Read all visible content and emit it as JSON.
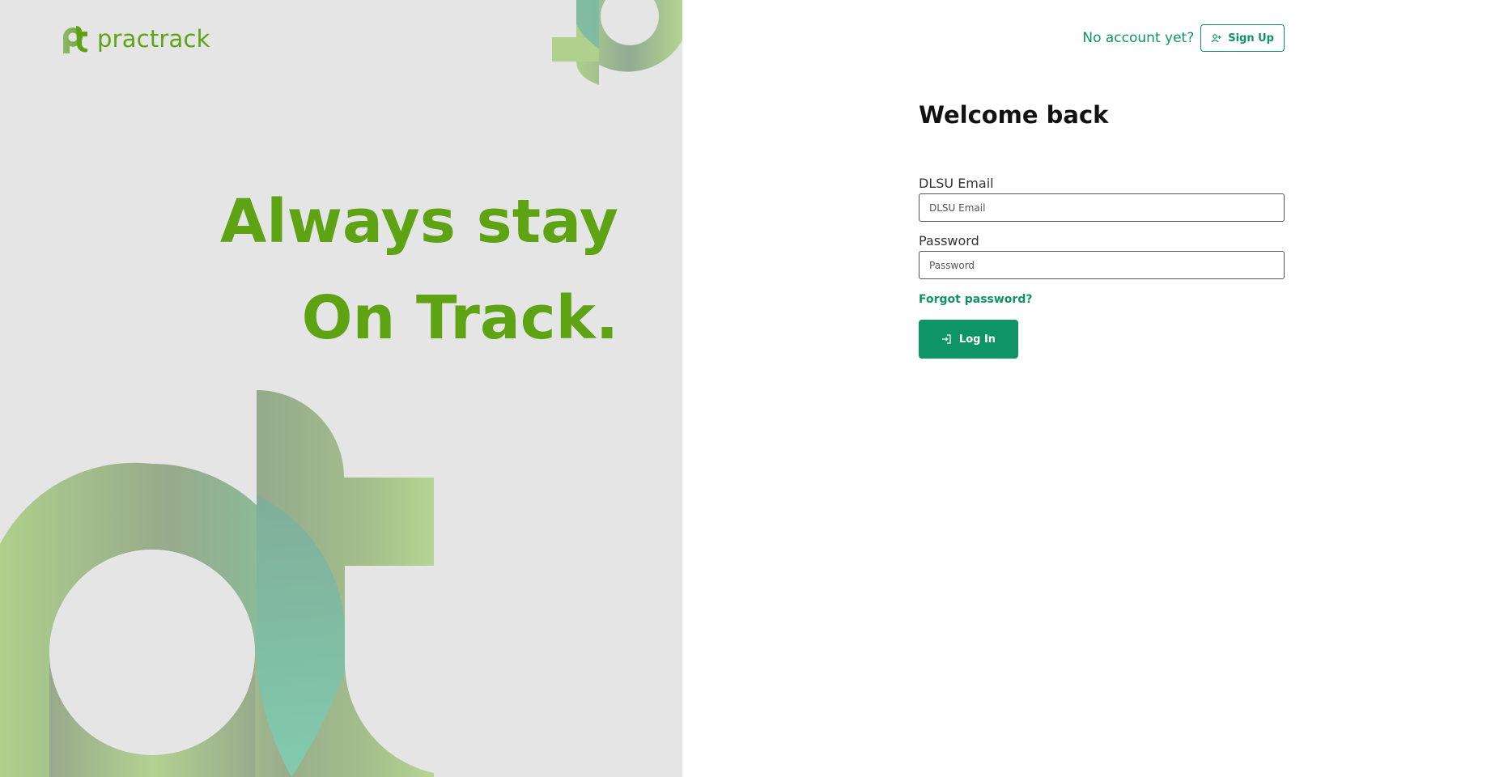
{
  "brand": {
    "name": "practrack",
    "logo_icon": "practrack-logo-icon",
    "brand_color": "#5da313",
    "accent_color": "#0f9468"
  },
  "hero": {
    "line1": "Always stay",
    "line2": "On Track."
  },
  "header": {
    "no_account_text": "No account yet?",
    "signup_label": "Sign Up",
    "signup_icon": "user-plus-icon"
  },
  "form": {
    "title": "Welcome back",
    "email": {
      "label": "DLSU Email",
      "placeholder": "DLSU Email",
      "value": ""
    },
    "password": {
      "label": "Password",
      "placeholder": "Password",
      "value": ""
    },
    "forgot_label": "Forgot password?",
    "login_label": "Log In",
    "login_icon": "login-icon"
  }
}
